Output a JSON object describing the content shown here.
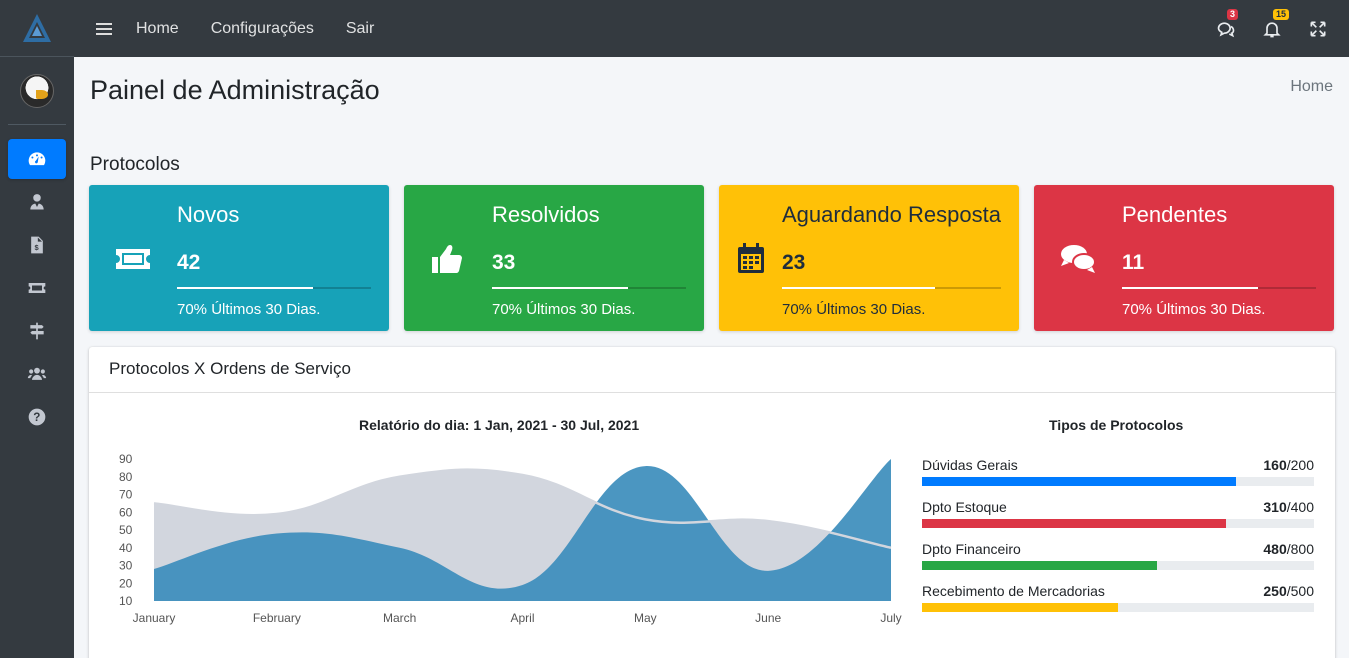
{
  "nav": {
    "links": [
      "Home",
      "Configurações",
      "Sair"
    ],
    "messages_badge": "3",
    "notifications_badge": "15"
  },
  "sidebar": {
    "items": [
      {
        "icon": "dashboard-icon",
        "active": true
      },
      {
        "icon": "user-tie-icon"
      },
      {
        "icon": "invoice-icon"
      },
      {
        "icon": "ticket-icon"
      },
      {
        "icon": "signpost-icon"
      },
      {
        "icon": "users-icon"
      },
      {
        "icon": "help-icon"
      }
    ]
  },
  "page": {
    "title": "Painel de Administração",
    "breadcrumb": "Home",
    "section_title": "Protocolos"
  },
  "boxes": [
    {
      "label": "Novos",
      "value": "42",
      "desc": "70% Últimos 30 Dias.",
      "progress": 0.7,
      "color": "#17a2b8",
      "icon": "ticket-icon"
    },
    {
      "label": "Resolvidos",
      "value": "33",
      "desc": "70% Últimos 30 Dias.",
      "progress": 0.7,
      "color": "#28a745",
      "icon": "thumbs-up-icon"
    },
    {
      "label": "Aguardando Resposta",
      "value": "23",
      "desc": "70% Últimos 30 Dias.",
      "progress": 0.7,
      "color": "#ffc107",
      "icon": "calendar-icon"
    },
    {
      "label": "Pendentes",
      "value": "11",
      "desc": "70% Últimos 30 Dias.",
      "progress": 0.7,
      "color": "#dc3545",
      "icon": "comments-icon"
    }
  ],
  "card": {
    "title": "Protocolos X Ordens de Serviço",
    "chart_title": "Relatório do dia: 1 Jan, 2021 - 30 Jul, 2021",
    "types_title": "Tipos de Protocolos",
    "types": [
      {
        "name": "Dúvidas Gerais",
        "value": "160",
        "total": "/200",
        "ratio": 0.8,
        "color": "#007bff"
      },
      {
        "name": "Dpto Estoque",
        "value": "310",
        "total": "/400",
        "ratio": 0.775,
        "color": "#dc3545"
      },
      {
        "name": "Dpto Financeiro",
        "value": "480",
        "total": "/800",
        "ratio": 0.6,
        "color": "#28a745"
      },
      {
        "name": "Recebimento de Mercadorias",
        "value": "250",
        "total": "/500",
        "ratio": 0.5,
        "color": "#ffc107"
      }
    ]
  },
  "chart_data": {
    "type": "area",
    "title": "Relatório do dia: 1 Jan, 2021 - 30 Jul, 2021",
    "categories": [
      "January",
      "February",
      "March",
      "April",
      "May",
      "June",
      "July"
    ],
    "y_ticks": [
      "90",
      "80",
      "70",
      "60",
      "50",
      "40",
      "30",
      "20",
      "10"
    ],
    "ylim": [
      10,
      90
    ],
    "series": [
      {
        "values": [
          65,
          59,
          80,
          81,
          56,
          55,
          40
        ],
        "color": "#d2d6de"
      },
      {
        "values": [
          28,
          48,
          40,
          19,
          86,
          27,
          90
        ],
        "color": "#3c8dbc"
      }
    ]
  }
}
